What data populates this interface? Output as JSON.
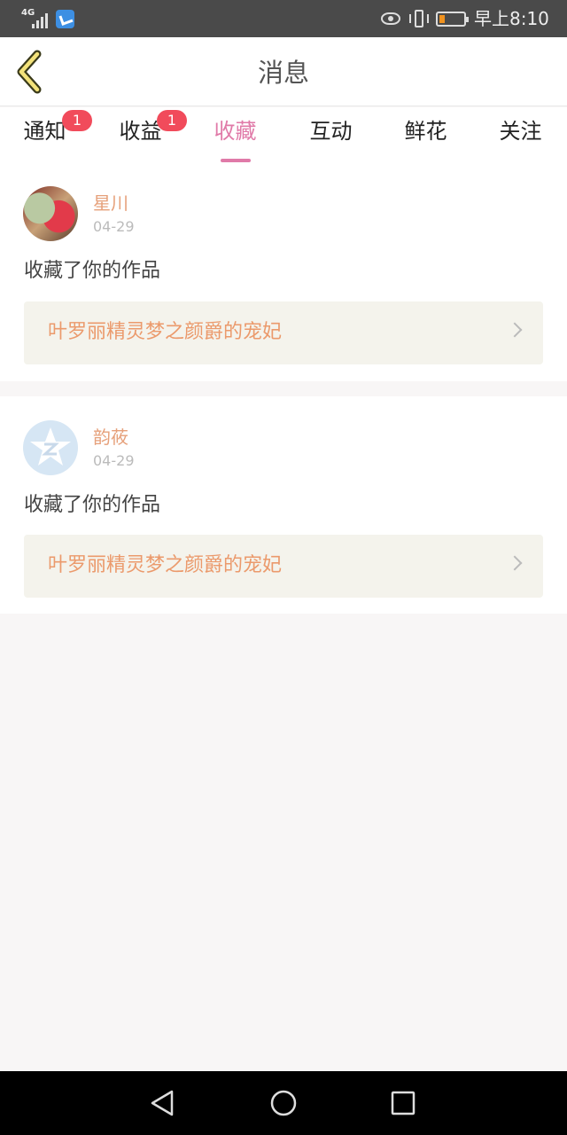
{
  "status_bar": {
    "network": "4G",
    "time": "早上8:10",
    "battery_color": "#f0921e"
  },
  "header": {
    "title": "消息",
    "back_icon": "chevron-left-icon"
  },
  "tabs": [
    {
      "label": "通知",
      "badge": "1",
      "active": false
    },
    {
      "label": "收益",
      "badge": "1",
      "active": false
    },
    {
      "label": "收藏",
      "badge": "",
      "active": true
    },
    {
      "label": "互动",
      "badge": "",
      "active": false
    },
    {
      "label": "鲜花",
      "badge": "",
      "active": false
    },
    {
      "label": "关注",
      "badge": "",
      "active": false
    }
  ],
  "messages": [
    {
      "user": "星川",
      "date": "04-29",
      "action": "收藏了你的作品",
      "work_title": "叶罗丽精灵梦之颜爵的宠妃"
    },
    {
      "user": "韵莜",
      "date": "04-29",
      "action": "收藏了你的作品",
      "work_title": "叶罗丽精灵梦之颜爵的宠妃"
    }
  ],
  "colors": {
    "accent": "#e07aa8",
    "badge": "#f14b5b",
    "username": "#e6a07a",
    "work_title": "#eb9a6c"
  }
}
